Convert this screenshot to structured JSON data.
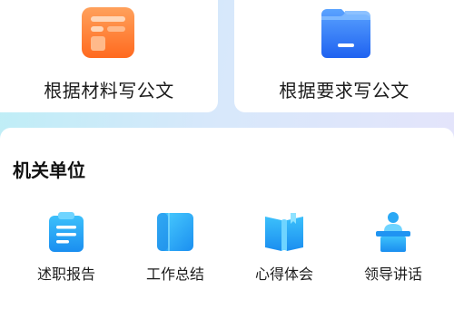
{
  "top_cards": [
    {
      "label": "根据材料写公文",
      "icon": "document-list-icon",
      "color": "#ff7a2e"
    },
    {
      "label": "根据要求写公文",
      "icon": "folder-icon",
      "color": "#2f74f6"
    }
  ],
  "section": {
    "title": "机关单位",
    "items": [
      {
        "label": "述职报告",
        "icon": "clipboard-icon"
      },
      {
        "label": "工作总结",
        "icon": "notebook-icon"
      },
      {
        "label": "心得体会",
        "icon": "open-book-icon"
      },
      {
        "label": "领导讲话",
        "icon": "speaker-podium-icon"
      }
    ]
  },
  "colors": {
    "accent_blue": "#2aa8f5",
    "accent_orange": "#ff7a2e"
  }
}
